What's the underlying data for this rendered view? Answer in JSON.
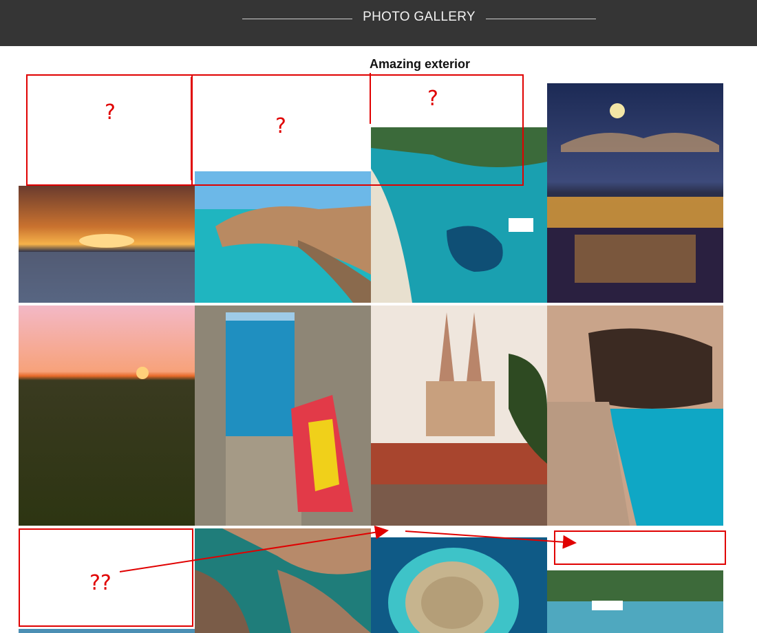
{
  "header": {
    "title": "PHOTO GALLERY"
  },
  "section": {
    "subtitle": "Amazing exterior"
  },
  "annotations": {
    "q1": "?",
    "q2": "?",
    "q3": "?",
    "q4": "??"
  },
  "colors": {
    "annotation": "#e00000",
    "header_bg": "#353535"
  }
}
